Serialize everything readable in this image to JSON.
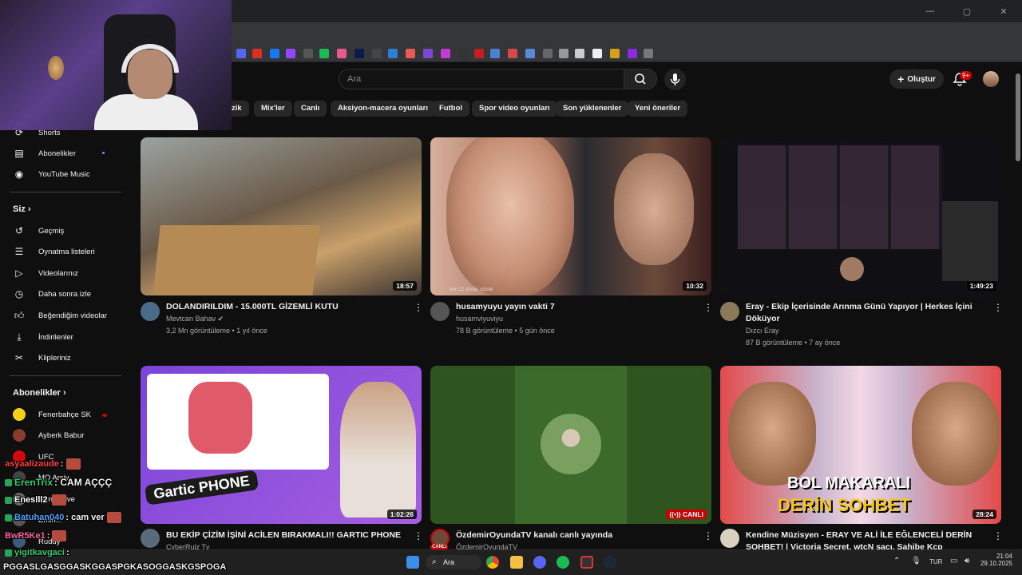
{
  "window": {
    "minimize": "—",
    "maximize": "▢",
    "close": "✕"
  },
  "youtube": {
    "search_placeholder": "Ara",
    "create_label": "Oluştur",
    "notif_count": "9+"
  },
  "chips": [
    "zik",
    "Mix'ler",
    "Canlı",
    "Aksiyon-macera oyunları",
    "Futbol",
    "Spor video oyunları",
    "Son yüklenenler",
    "Yeni öneriler"
  ],
  "sidebar": {
    "top_items": [
      {
        "label": "Shorts",
        "icon": "shorts-icon"
      },
      {
        "label": "Abonelikler",
        "icon": "subscriptions-icon"
      },
      {
        "label": "YouTube Music",
        "icon": "music-icon"
      }
    ],
    "you_header": "Siz",
    "you_items": [
      {
        "label": "Geçmiş",
        "icon": "history-icon"
      },
      {
        "label": "Oynatma listeleri",
        "icon": "playlist-icon"
      },
      {
        "label": "Videolarınız",
        "icon": "your-videos-icon"
      },
      {
        "label": "Daha sonra izle",
        "icon": "watch-later-icon"
      },
      {
        "label": "Beğendiğim videolar",
        "icon": "liked-icon"
      },
      {
        "label": "İndirilenler",
        "icon": "download-icon"
      },
      {
        "label": "Klipleriniz",
        "icon": "clips-icon"
      }
    ],
    "subs_header": "Abonelikler",
    "subs_items": [
      {
        "label": "Fenerbahçe SK",
        "color": "#f7d117"
      },
      {
        "label": "Ayberk Babur",
        "color": "#8a3b2e"
      },
      {
        "label": "UFC",
        "color": "#d20a0a"
      },
      {
        "label": "MO Arşiv",
        "color": "#444444"
      },
      {
        "label": "Gen... Live",
        "color": "#666666"
      },
      {
        "label": "Emin...",
        "color": "#555555"
      },
      {
        "label": "Ruddy",
        "color": "#3d5a7a"
      }
    ]
  },
  "videos": [
    {
      "title": "DOLANDIRILDIM - 15.000TL GİZEMLİ KUTU",
      "title2": "",
      "channel": "Mevtcan Bahav",
      "meta": "3,2 Mn görüntüleme • 1 yıl önce",
      "duration": "18:57",
      "thumb": "#6b5a48"
    },
    {
      "title": "husamyuyu yayın vakti 7",
      "title2": "",
      "channel": "husamviyuviyu",
      "meta": "78 B görüntüleme • 5 gün önce",
      "duration": "10:32",
      "thumb": "#7a4a3c",
      "overlay_text": "ben 22 olmaz sizinle"
    },
    {
      "title": "Eray - Ekip İçerisinde Arınma Günü Yapıyor | Herkes İçini",
      "title2": "Döküyor",
      "channel": "Dızcı Eray",
      "meta": "87 B görüntüleme • 7 ay önce",
      "duration": "1:49:23",
      "thumb": "#1a1a22"
    },
    {
      "title": "BU EKİP ÇİZİM İŞİNİ ACİLEN BIRAKMALI!! GARTIC PHONE",
      "title2": "",
      "channel": "CyberRulz Tv",
      "meta": "",
      "duration": "1:02:26",
      "thumb": "#6f3fb5",
      "thumb_text": "Gartic PHONE"
    },
    {
      "title": "ÖzdemirOyundaTV kanalı canlı yayında",
      "title2": "",
      "channel": "ÖzdemirOyundaTV",
      "meta": "",
      "live": "CANLI",
      "thumb": "#3c6a2a",
      "ava_badge": "CANLI"
    },
    {
      "title": "Kendine Müzisyen - ERAY VE ALİ İLE EĞLENCELİ DERİN",
      "title2": "SOHBET! | Victoria Secret, wtcN saçı, Sahibe Kcp",
      "channel": "",
      "meta": "",
      "duration": "28:24",
      "thumb": "#c9b6cf",
      "thumb_text1": "BOL MAKARALI",
      "thumb_text2": "DERİN SOHBET"
    }
  ],
  "chat": [
    {
      "user": "asyaalizaude",
      "msg": ":",
      "color": "#ff3b3b"
    },
    {
      "user": "ErenTrix",
      "msg": ": CAM AÇÇÇ",
      "color": "#2ecc71"
    },
    {
      "user": "Eneslll2",
      "msg": "",
      "color": "#ffffff"
    },
    {
      "user": "Batuhan040",
      "msg": ": cam ver",
      "color": "#4aa3ff"
    },
    {
      "user": "BwR5Ke1",
      "msg": ":",
      "color": "#ff5fa2"
    },
    {
      "user": "yigitkavgaci",
      "msg": ":",
      "color": "#2ecc71"
    },
    {
      "user": "",
      "msg": "PGGASLGASGGASKGGASPGKASOGGASKGSPOGA",
      "color": "#ffffff"
    }
  ],
  "taskbar": {
    "search": "Ara",
    "lang": "TUR",
    "time": "21:04",
    "date": "29.10.2025"
  }
}
